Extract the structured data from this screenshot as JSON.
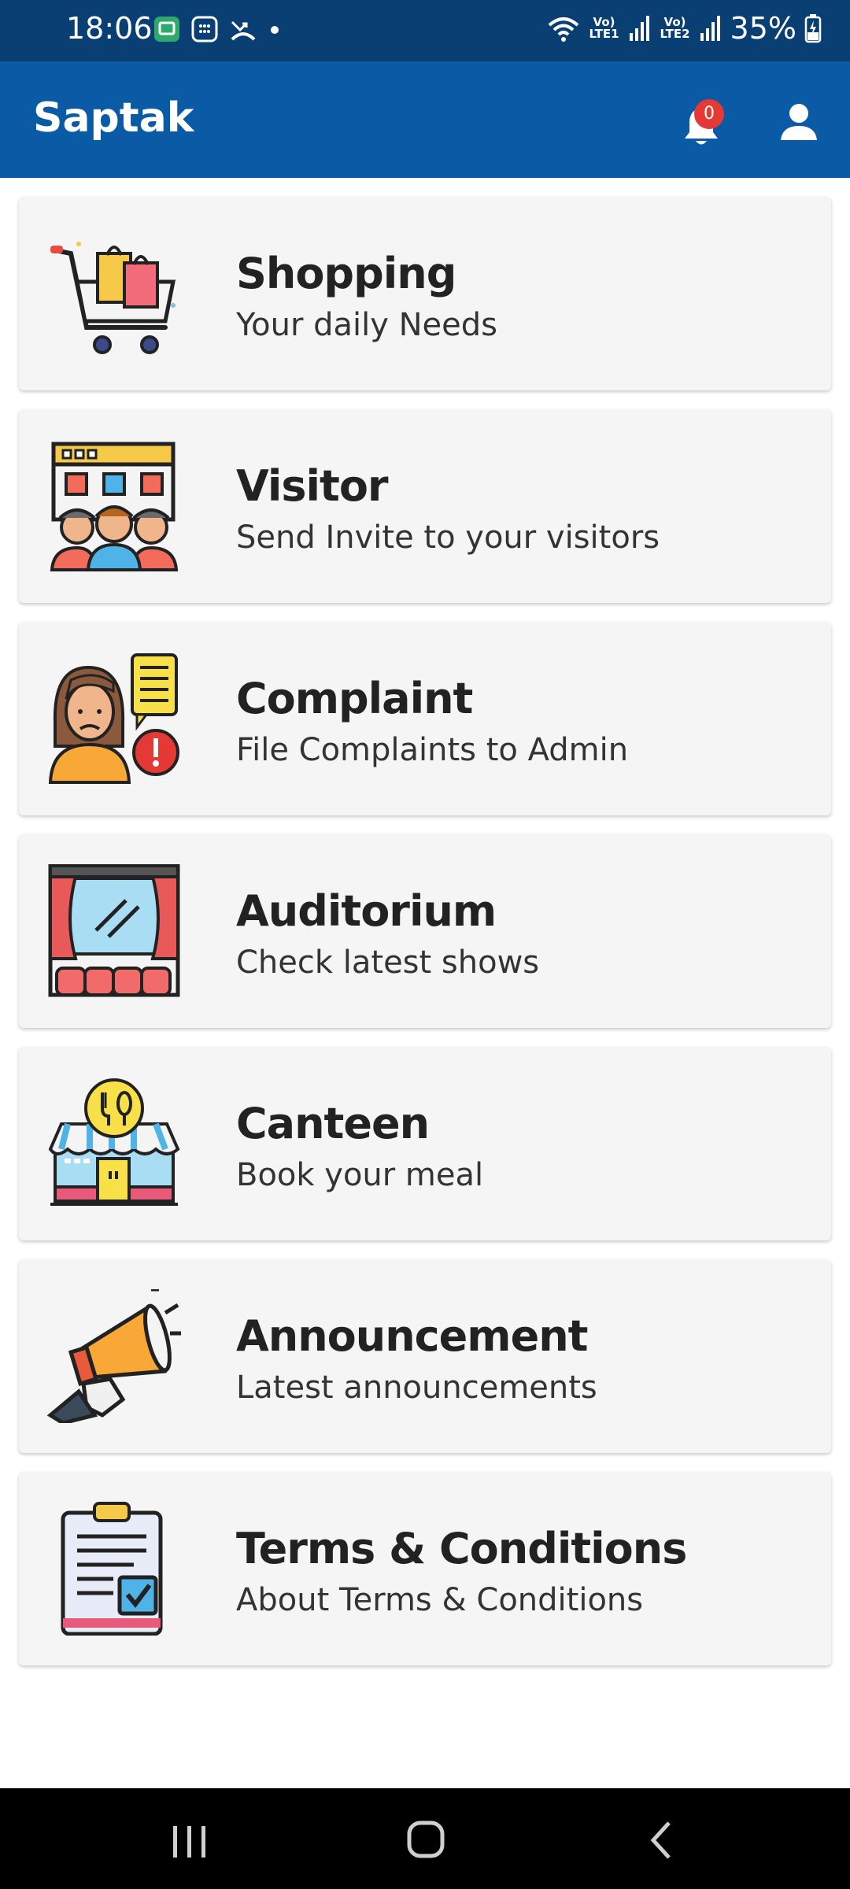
{
  "status_bar": {
    "time": "18:06",
    "battery": "35%",
    "sim1": "Vo) LTE1",
    "sim2": "Vo) LTE2",
    "left_icons": [
      "message-app-icon",
      "calculator-icon",
      "missed-call-icon",
      "dot-icon"
    ],
    "right_icons": [
      "wifi-icon",
      "signal-icon",
      "signal-icon",
      "battery-charging-icon"
    ]
  },
  "app_bar": {
    "title": "Saptak",
    "notification_count": "0",
    "accent": "#0a5aa5"
  },
  "menu": {
    "items": [
      {
        "title": "Shopping",
        "subtitle": "Your daily Needs",
        "icon": "shopping-cart-icon"
      },
      {
        "title": "Visitor",
        "subtitle": "Send Invite to your visitors",
        "icon": "visitor-group-icon"
      },
      {
        "title": "Complaint",
        "subtitle": "File Complaints to Admin",
        "icon": "complaint-person-icon"
      },
      {
        "title": "Auditorium",
        "subtitle": "Check latest shows",
        "icon": "theater-stage-icon"
      },
      {
        "title": "Canteen",
        "subtitle": "Book your meal",
        "icon": "canteen-shop-icon"
      },
      {
        "title": "Announcement",
        "subtitle": "Latest announcements",
        "icon": "megaphone-icon"
      },
      {
        "title": "Terms & Conditions",
        "subtitle": "About Terms & Conditions",
        "icon": "clipboard-check-icon"
      }
    ]
  },
  "nav_bar": {
    "icons": [
      "recent-apps-icon",
      "home-icon",
      "back-icon"
    ]
  }
}
